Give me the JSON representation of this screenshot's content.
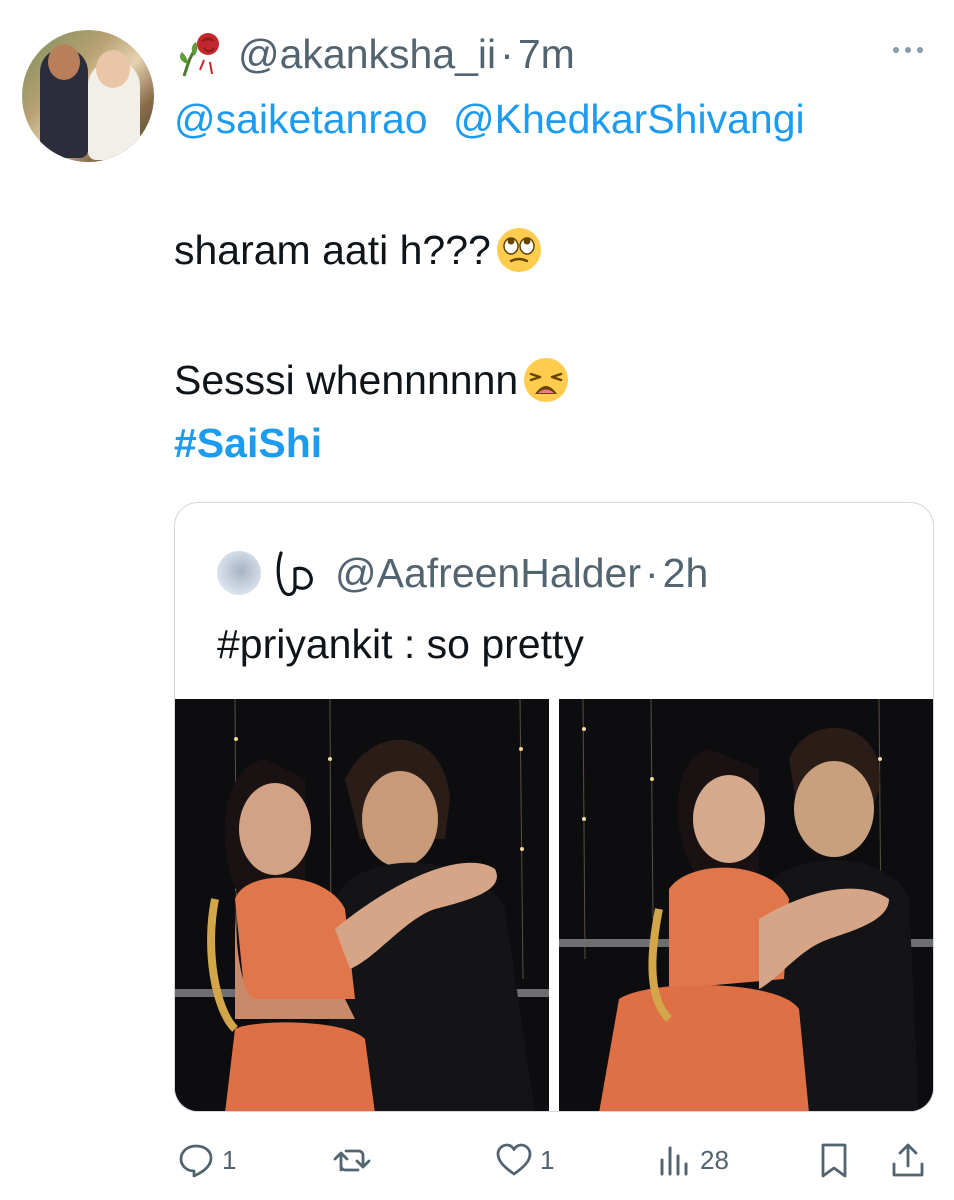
{
  "tweet": {
    "handle": "@akanksha_ii",
    "separator": "·",
    "time": "7m",
    "mentions": [
      "@saiketanrao",
      "@KhedkarShivangi"
    ],
    "line1": "sharam aati h???",
    "line2": "Sesssi whennnnnn",
    "hashtag": "#SaiShi",
    "icons": {
      "name_emoji": "wilted-rose-icon",
      "line1_emoji": "eye-roll-emoji-icon",
      "line2_emoji": "weary-face-emoji-icon",
      "more": "more-options-icon"
    }
  },
  "quoted": {
    "handle": "@AafreenHalder",
    "separator": "·",
    "time": "2h",
    "text": "#priyankit : so pretty",
    "icons": {
      "logo": "threads-logo-icon"
    }
  },
  "actions": {
    "reply_count": "1",
    "retweet_count": "",
    "like_count": "1",
    "views_count": "28"
  },
  "colors": {
    "accent": "#1d9bf0",
    "secondary_text": "#536471",
    "primary_text": "#0f1419",
    "border": "#cfd9de"
  }
}
